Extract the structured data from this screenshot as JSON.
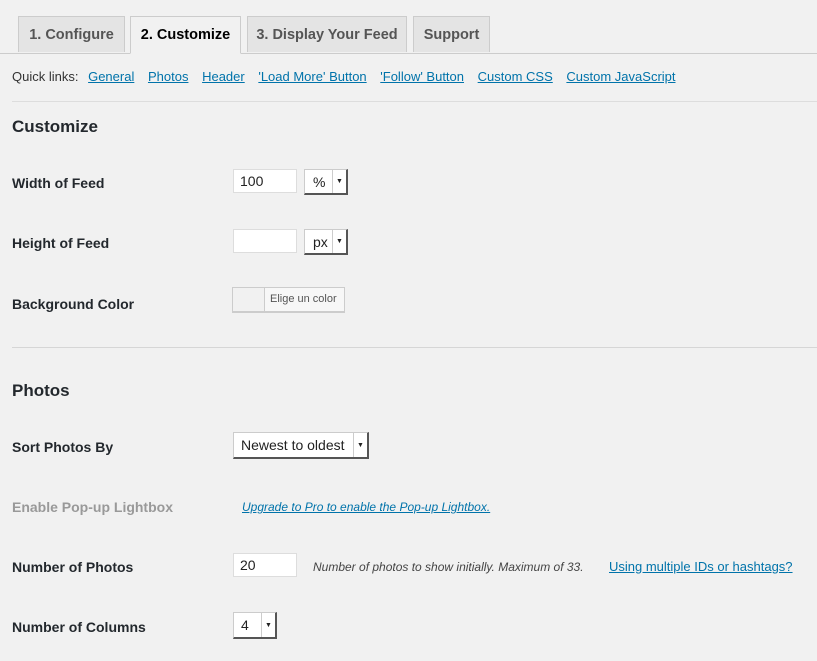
{
  "tabs": [
    {
      "label": "1. Configure"
    },
    {
      "label": "2. Customize"
    },
    {
      "label": "3. Display Your Feed"
    },
    {
      "label": "Support"
    }
  ],
  "quick_links": {
    "label": "Quick links:",
    "items": [
      "General",
      "Photos",
      "Header",
      "'Load More' Button",
      "'Follow' Button",
      "Custom CSS",
      "Custom JavaScript"
    ]
  },
  "customize": {
    "title": "Customize",
    "width": {
      "label": "Width of Feed",
      "value": "100",
      "unit": "%"
    },
    "height": {
      "label": "Height of Feed",
      "value": "",
      "unit": "px"
    },
    "background": {
      "label": "Background Color",
      "button_label": "Elige un color"
    }
  },
  "photos": {
    "title": "Photos",
    "sort": {
      "label": "Sort Photos By",
      "value": "Newest to oldest"
    },
    "lightbox": {
      "label": "Enable Pop-up Lightbox",
      "link": "Upgrade to Pro to enable the Pop-up Lightbox."
    },
    "number": {
      "label": "Number of Photos",
      "value": "20",
      "hint": "Number of photos to show initially. Maximum of 33.",
      "link": "Using multiple IDs or hashtags?"
    },
    "columns": {
      "label": "Number of Columns",
      "value": "4"
    }
  },
  "colors": {
    "link": "#0073aa",
    "background": "#f1f1f1"
  }
}
